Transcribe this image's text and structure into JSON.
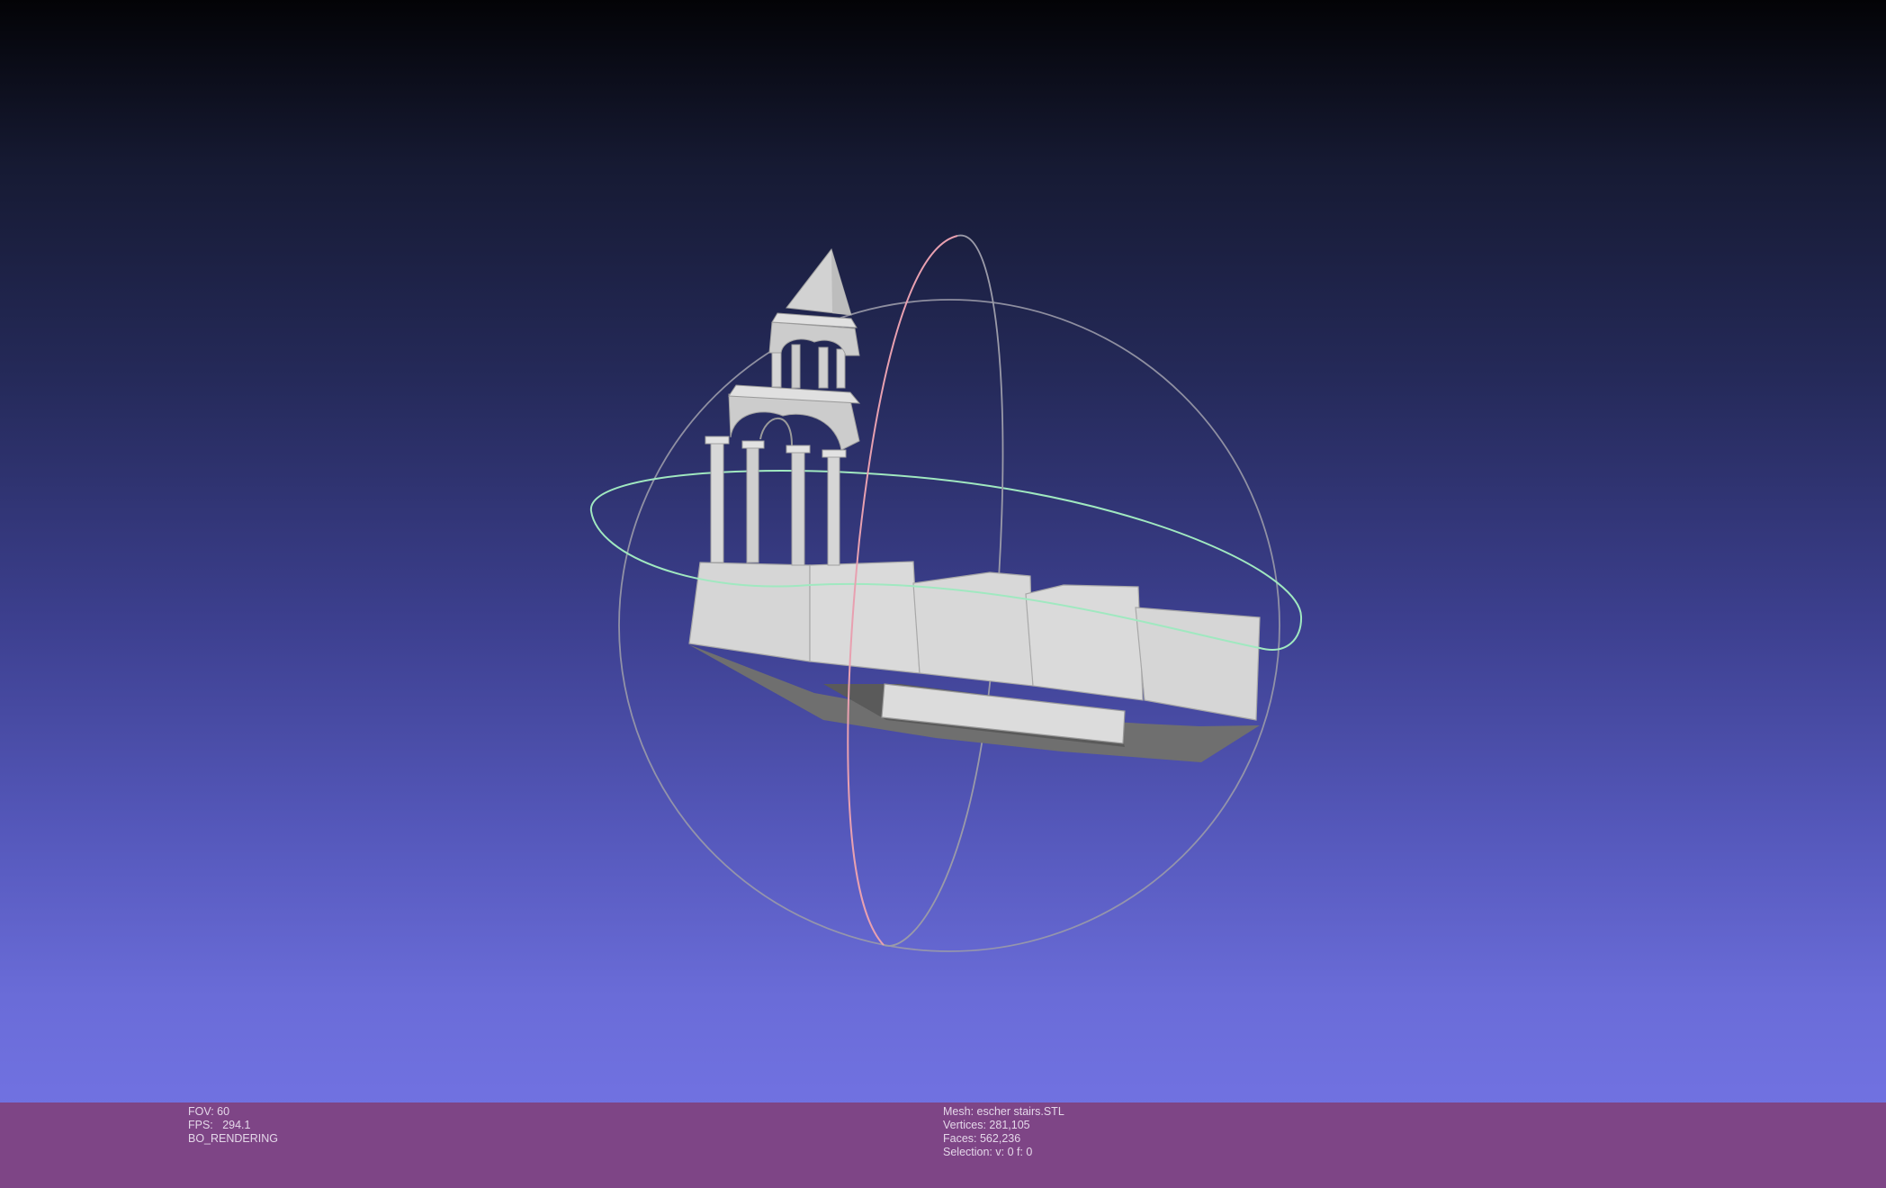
{
  "viewer": {
    "colors": {
      "background_top": "#030306",
      "background_bottom": "#7676e8",
      "infobar": "#7e4586",
      "model": "#dcdcdc",
      "trackball_x": "#e8a0b0",
      "trackball_y": "#a0e8c0",
      "trackball_z": "#9a9aa8"
    }
  },
  "status_left": {
    "fov": "FOV: 60",
    "fps": "FPS:   294.1",
    "mode": "BO_RENDERING"
  },
  "status_right": {
    "mesh": "Mesh: escher stairs.STL",
    "vertices": "Vertices: 281,105",
    "faces": "Faces: 562,236",
    "selection": "Selection: v: 0 f: 0"
  }
}
